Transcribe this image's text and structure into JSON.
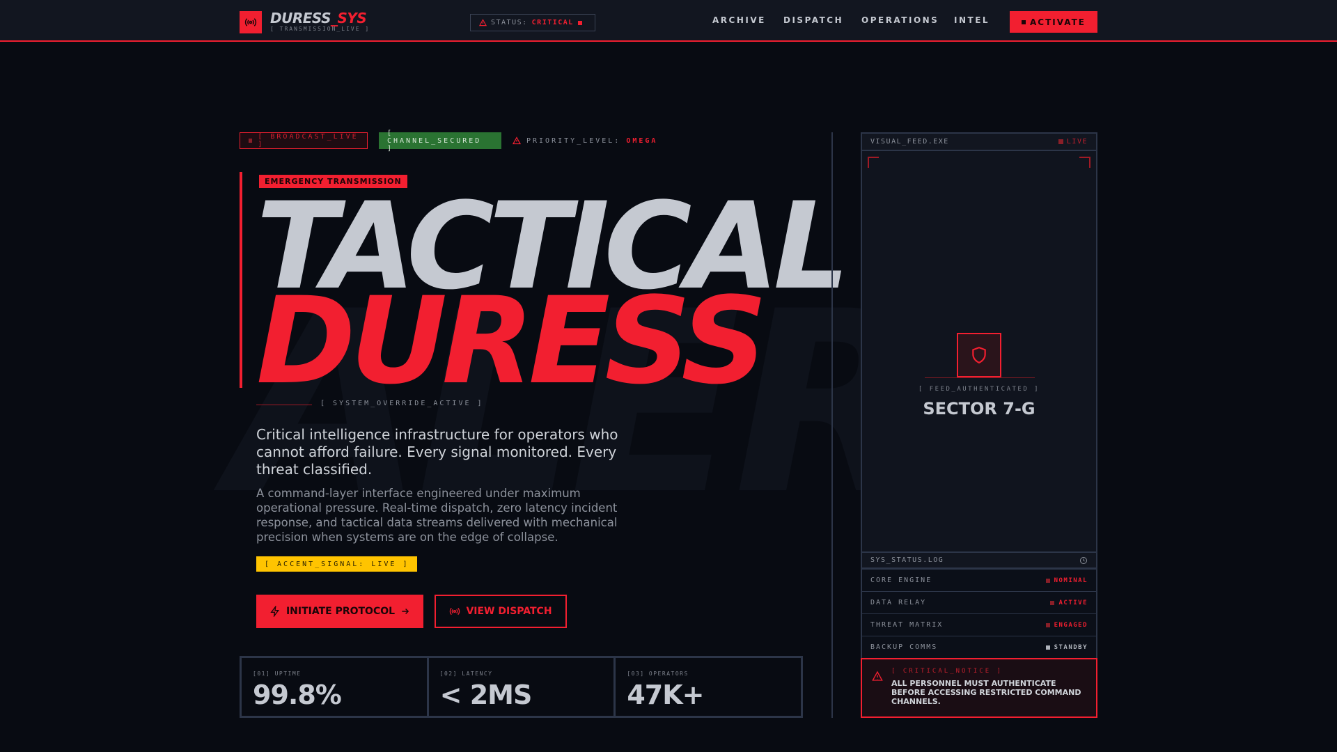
{
  "header": {
    "brand_main": "DURESS",
    "brand_accent": "_SYS",
    "brand_sub": "[ TRANSMISSION_LIVE ]",
    "status_label": "STATUS:",
    "status_value": "CRITICAL",
    "nav": [
      "ARCHIVE",
      "DISPATCH",
      "OPERATIONS",
      "INTEL"
    ],
    "activate_label": "ACTIVATE"
  },
  "badges": {
    "broadcast": "[ BROADCAST_LIVE ]",
    "channel": "[ CHANNEL_SECURED ]",
    "priority_label": "PRIORITY_LEVEL:",
    "priority_value": "OMEGA"
  },
  "hero": {
    "watermark": "ALERT",
    "tag": "EMERGENCY TRANSMISSION",
    "title_line1": "TACTICAL",
    "title_line2": "DURESS",
    "override": "[ SYSTEM_OVERRIDE_ACTIVE ]",
    "lead": "Critical intelligence infrastructure for operators who cannot afford failure. Every signal monitored. Every threat classified.",
    "body": "A command-layer interface engineered under maximum operational pressure. Real-time dispatch, zero latency incident response, and tactical data streams delivered with mechanical precision when systems are on the edge of collapse.",
    "accent": "[ ACCENT_SIGNAL: LIVE ]",
    "primary_button": "INITIATE PROTOCOL",
    "secondary_button": "VIEW DISPATCH"
  },
  "stats": [
    {
      "label": "[01] UPTIME",
      "value": "99.8%"
    },
    {
      "label": "[02] LATENCY",
      "value": "< 2MS"
    },
    {
      "label": "[03] OPERATORS",
      "value": "47K+"
    }
  ],
  "panel": {
    "feed_title": "VISUAL_FEED.EXE",
    "feed_status": "LIVE",
    "feed_auth": "[ FEED_AUTHENTICATED ]",
    "sector": "SECTOR 7-G",
    "log_title": "SYS_STATUS.LOG",
    "rows": [
      {
        "name": "CORE ENGINE",
        "status": "NOMINAL"
      },
      {
        "name": "DATA RELAY",
        "status": "ACTIVE"
      },
      {
        "name": "THREAT MATRIX",
        "status": "ENGAGED"
      },
      {
        "name": "BACKUP COMMS",
        "status": "STANDBY"
      }
    ],
    "notice_title": "[ CRITICAL_NOTICE ]",
    "notice_text": "ALL PERSONNEL MUST AUTHENTICATE BEFORE ACCESSING RESTRICTED COMMAND CHANNELS."
  },
  "colors": {
    "accent": "#f21f30",
    "secured": "#2a7332",
    "signal": "#ffc400",
    "bg": "#080b12"
  }
}
